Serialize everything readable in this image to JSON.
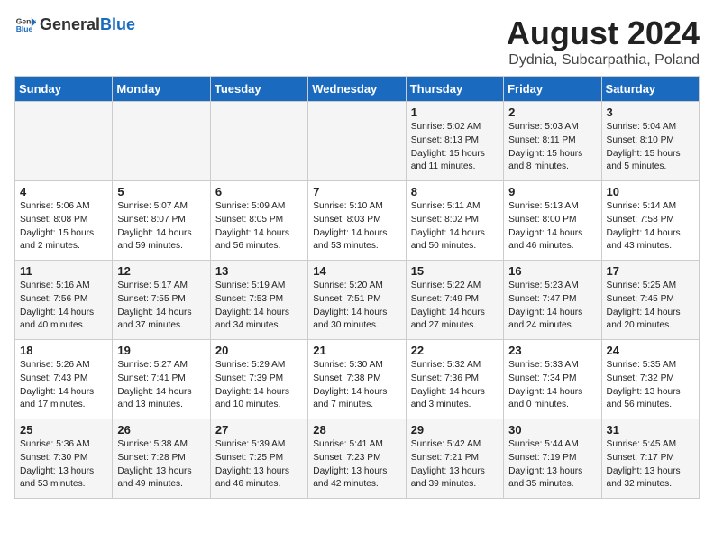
{
  "header": {
    "logo_general": "General",
    "logo_blue": "Blue",
    "month_year": "August 2024",
    "location": "Dydnia, Subcarpathia, Poland"
  },
  "days_of_week": [
    "Sunday",
    "Monday",
    "Tuesday",
    "Wednesday",
    "Thursday",
    "Friday",
    "Saturday"
  ],
  "weeks": [
    [
      {
        "day": "",
        "info": ""
      },
      {
        "day": "",
        "info": ""
      },
      {
        "day": "",
        "info": ""
      },
      {
        "day": "",
        "info": ""
      },
      {
        "day": "1",
        "info": "Sunrise: 5:02 AM\nSunset: 8:13 PM\nDaylight: 15 hours\nand 11 minutes."
      },
      {
        "day": "2",
        "info": "Sunrise: 5:03 AM\nSunset: 8:11 PM\nDaylight: 15 hours\nand 8 minutes."
      },
      {
        "day": "3",
        "info": "Sunrise: 5:04 AM\nSunset: 8:10 PM\nDaylight: 15 hours\nand 5 minutes."
      }
    ],
    [
      {
        "day": "4",
        "info": "Sunrise: 5:06 AM\nSunset: 8:08 PM\nDaylight: 15 hours\nand 2 minutes."
      },
      {
        "day": "5",
        "info": "Sunrise: 5:07 AM\nSunset: 8:07 PM\nDaylight: 14 hours\nand 59 minutes."
      },
      {
        "day": "6",
        "info": "Sunrise: 5:09 AM\nSunset: 8:05 PM\nDaylight: 14 hours\nand 56 minutes."
      },
      {
        "day": "7",
        "info": "Sunrise: 5:10 AM\nSunset: 8:03 PM\nDaylight: 14 hours\nand 53 minutes."
      },
      {
        "day": "8",
        "info": "Sunrise: 5:11 AM\nSunset: 8:02 PM\nDaylight: 14 hours\nand 50 minutes."
      },
      {
        "day": "9",
        "info": "Sunrise: 5:13 AM\nSunset: 8:00 PM\nDaylight: 14 hours\nand 46 minutes."
      },
      {
        "day": "10",
        "info": "Sunrise: 5:14 AM\nSunset: 7:58 PM\nDaylight: 14 hours\nand 43 minutes."
      }
    ],
    [
      {
        "day": "11",
        "info": "Sunrise: 5:16 AM\nSunset: 7:56 PM\nDaylight: 14 hours\nand 40 minutes."
      },
      {
        "day": "12",
        "info": "Sunrise: 5:17 AM\nSunset: 7:55 PM\nDaylight: 14 hours\nand 37 minutes."
      },
      {
        "day": "13",
        "info": "Sunrise: 5:19 AM\nSunset: 7:53 PM\nDaylight: 14 hours\nand 34 minutes."
      },
      {
        "day": "14",
        "info": "Sunrise: 5:20 AM\nSunset: 7:51 PM\nDaylight: 14 hours\nand 30 minutes."
      },
      {
        "day": "15",
        "info": "Sunrise: 5:22 AM\nSunset: 7:49 PM\nDaylight: 14 hours\nand 27 minutes."
      },
      {
        "day": "16",
        "info": "Sunrise: 5:23 AM\nSunset: 7:47 PM\nDaylight: 14 hours\nand 24 minutes."
      },
      {
        "day": "17",
        "info": "Sunrise: 5:25 AM\nSunset: 7:45 PM\nDaylight: 14 hours\nand 20 minutes."
      }
    ],
    [
      {
        "day": "18",
        "info": "Sunrise: 5:26 AM\nSunset: 7:43 PM\nDaylight: 14 hours\nand 17 minutes."
      },
      {
        "day": "19",
        "info": "Sunrise: 5:27 AM\nSunset: 7:41 PM\nDaylight: 14 hours\nand 13 minutes."
      },
      {
        "day": "20",
        "info": "Sunrise: 5:29 AM\nSunset: 7:39 PM\nDaylight: 14 hours\nand 10 minutes."
      },
      {
        "day": "21",
        "info": "Sunrise: 5:30 AM\nSunset: 7:38 PM\nDaylight: 14 hours\nand 7 minutes."
      },
      {
        "day": "22",
        "info": "Sunrise: 5:32 AM\nSunset: 7:36 PM\nDaylight: 14 hours\nand 3 minutes."
      },
      {
        "day": "23",
        "info": "Sunrise: 5:33 AM\nSunset: 7:34 PM\nDaylight: 14 hours\nand 0 minutes."
      },
      {
        "day": "24",
        "info": "Sunrise: 5:35 AM\nSunset: 7:32 PM\nDaylight: 13 hours\nand 56 minutes."
      }
    ],
    [
      {
        "day": "25",
        "info": "Sunrise: 5:36 AM\nSunset: 7:30 PM\nDaylight: 13 hours\nand 53 minutes."
      },
      {
        "day": "26",
        "info": "Sunrise: 5:38 AM\nSunset: 7:28 PM\nDaylight: 13 hours\nand 49 minutes."
      },
      {
        "day": "27",
        "info": "Sunrise: 5:39 AM\nSunset: 7:25 PM\nDaylight: 13 hours\nand 46 minutes."
      },
      {
        "day": "28",
        "info": "Sunrise: 5:41 AM\nSunset: 7:23 PM\nDaylight: 13 hours\nand 42 minutes."
      },
      {
        "day": "29",
        "info": "Sunrise: 5:42 AM\nSunset: 7:21 PM\nDaylight: 13 hours\nand 39 minutes."
      },
      {
        "day": "30",
        "info": "Sunrise: 5:44 AM\nSunset: 7:19 PM\nDaylight: 13 hours\nand 35 minutes."
      },
      {
        "day": "31",
        "info": "Sunrise: 5:45 AM\nSunset: 7:17 PM\nDaylight: 13 hours\nand 32 minutes."
      }
    ]
  ]
}
